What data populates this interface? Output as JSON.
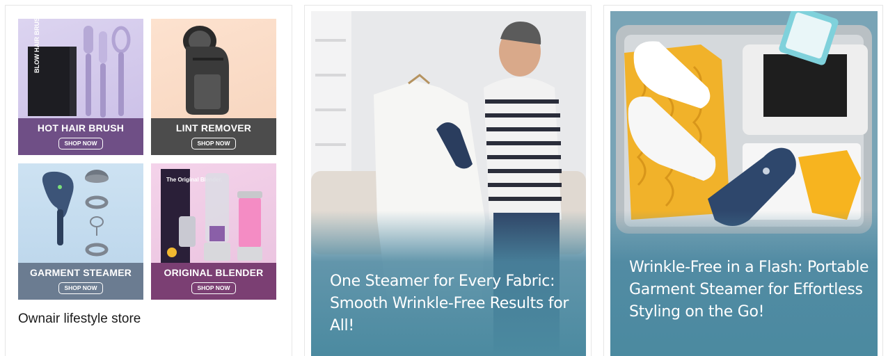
{
  "store_card": {
    "tiles": [
      {
        "title": "HOT HAIR BRUSH",
        "button": "SHOP NOW"
      },
      {
        "title": "LINT REMOVER",
        "button": "SHOP NOW"
      },
      {
        "title": "GARMENT STEAMER",
        "button": "SHOP NOW"
      },
      {
        "title": "ORIGINAL BLENDER",
        "button": "SHOP NOW"
      }
    ],
    "store_name": "Ownair lifestyle store",
    "product_text": {
      "blow_brush": "BLOW HAIR BRUSH",
      "blender": "The Original Blender."
    }
  },
  "promo_cards": [
    {
      "caption": "One Steamer for Every Fabric: Smooth Wrinkle-Free Results for All!"
    },
    {
      "caption": "Wrinkle-Free in a Flash: Portable Garment Steamer for Effortless Styling on the Go!"
    }
  ],
  "colors": {
    "band_purple": "#6f4f86",
    "band_gray": "#4c4c4c",
    "band_steel": "#6b7c91",
    "band_plum": "#7b3f73",
    "caption_teal": "#4b8aa0"
  }
}
